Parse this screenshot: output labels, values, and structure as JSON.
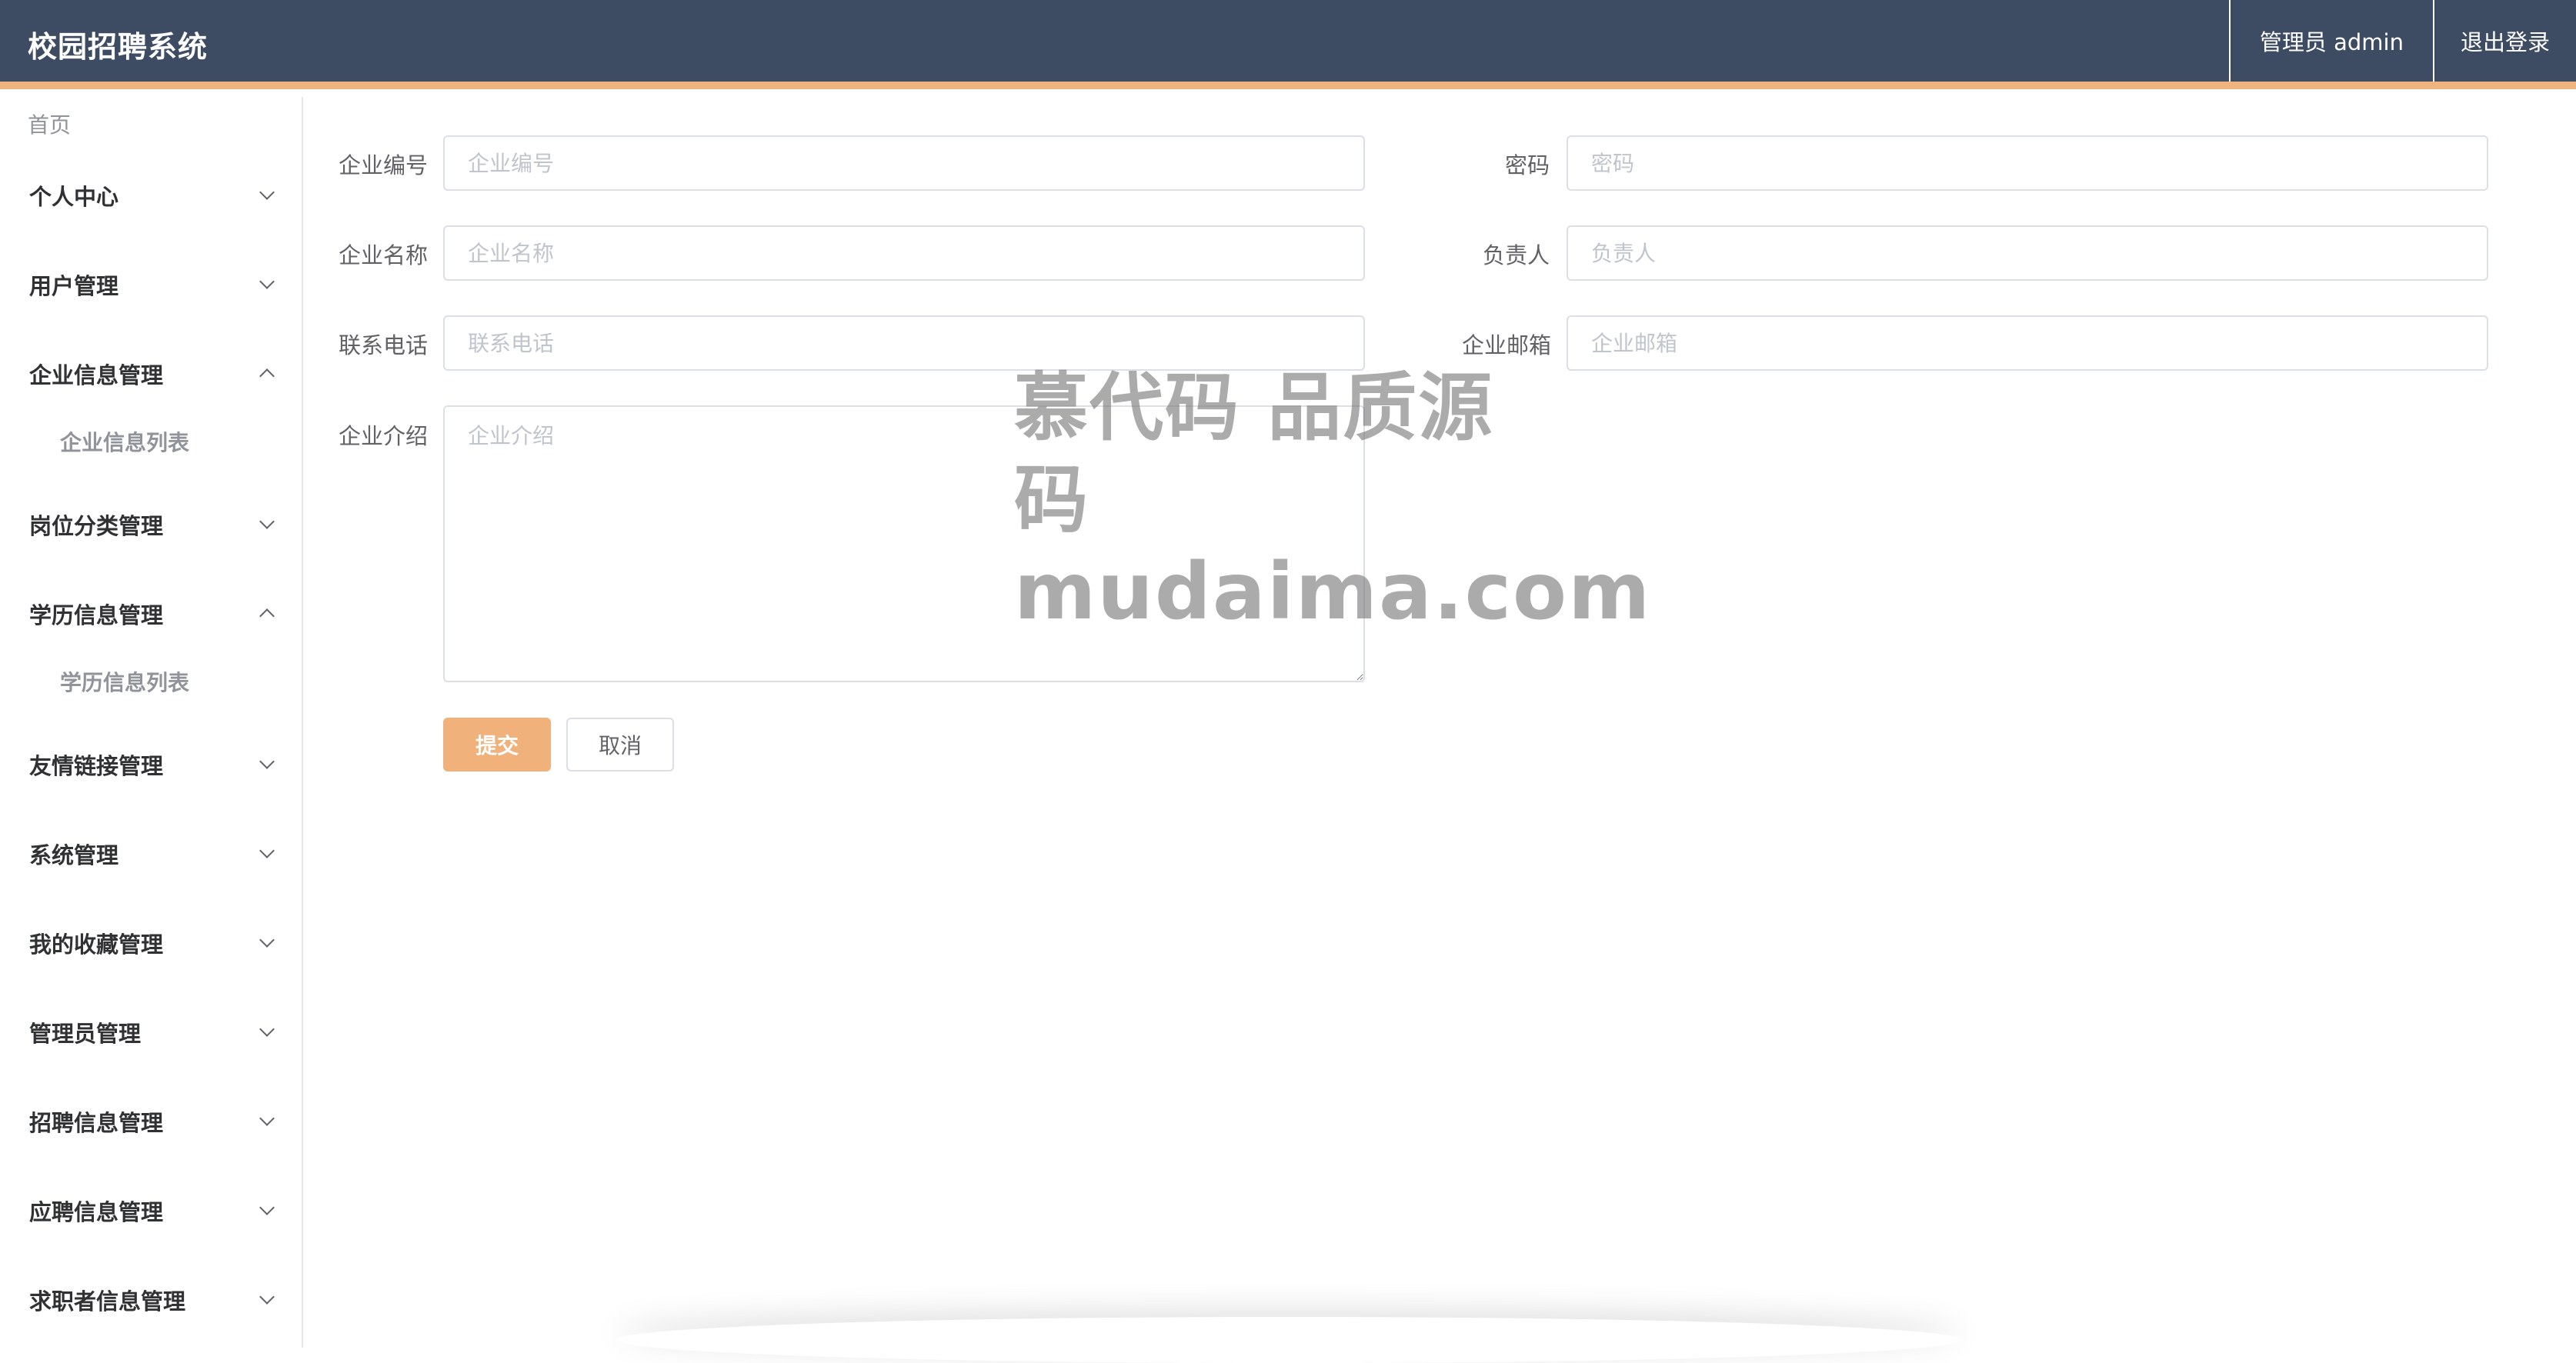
{
  "app": {
    "title": "校园招聘系统"
  },
  "header": {
    "user_label": "管理员 admin",
    "logout_label": "退出登录"
  },
  "sidebar": {
    "home": "首页",
    "groups": [
      {
        "label": "个人中心",
        "expanded": false
      },
      {
        "label": "用户管理",
        "expanded": false
      },
      {
        "label": "企业信息管理",
        "expanded": true,
        "sub": "企业信息列表"
      },
      {
        "label": "岗位分类管理",
        "expanded": false
      },
      {
        "label": "学历信息管理",
        "expanded": true,
        "sub": "学历信息列表"
      },
      {
        "label": "友情链接管理",
        "expanded": false
      },
      {
        "label": "系统管理",
        "expanded": false
      },
      {
        "label": "我的收藏管理",
        "expanded": false
      },
      {
        "label": "管理员管理",
        "expanded": false
      },
      {
        "label": "招聘信息管理",
        "expanded": false
      },
      {
        "label": "应聘信息管理",
        "expanded": false
      },
      {
        "label": "求职者信息管理",
        "expanded": false
      }
    ]
  },
  "form": {
    "company_no": {
      "label": "企业编号",
      "placeholder": "企业编号",
      "value": ""
    },
    "password": {
      "label": "密码",
      "placeholder": "密码",
      "value": ""
    },
    "company_name": {
      "label": "企业名称",
      "placeholder": "企业名称",
      "value": ""
    },
    "manager": {
      "label": "负责人",
      "placeholder": "负责人",
      "value": ""
    },
    "phone": {
      "label": "联系电话",
      "placeholder": "联系电话",
      "value": ""
    },
    "email": {
      "label": "企业邮箱",
      "placeholder": "企业邮箱",
      "value": ""
    },
    "intro": {
      "label": "企业介绍",
      "placeholder": "企业介绍",
      "value": ""
    },
    "submit_label": "提交",
    "cancel_label": "取消"
  },
  "watermark": {
    "line1": "慕代码 品质源码",
    "line2": "mudaima.com"
  },
  "colors": {
    "header_bg": "#3d4b63",
    "accent": "#efb581",
    "submit_bg": "#f0b27a"
  }
}
